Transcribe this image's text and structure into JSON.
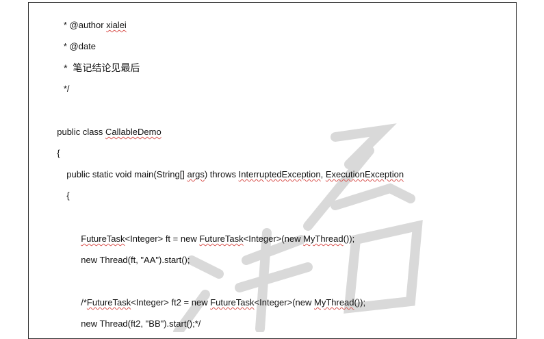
{
  "document": {
    "lines": [
      {
        "text": " * @author ",
        "word": "xialei"
      },
      {
        "text": " * @date"
      },
      {
        "text": " *  笔记结论见最后"
      },
      {
        "text": " */"
      },
      {
        "text": "public class ",
        "word": "CallableDemo"
      },
      {
        "text": "{"
      },
      {
        "pre": "public static void main(String[] ",
        "word": "args",
        "mid": ") throws ",
        "word2": "InterruptedException",
        "sep": ", ",
        "word3": "ExecutionException"
      },
      {
        "text": "{"
      },
      {
        "word": "FutureTask",
        "mid": "<Integer> ft = new ",
        "word2": "FutureTask",
        "mid2": "<Integer>(new ",
        "word3": "MyThread",
        "post": "());"
      },
      {
        "text": "new Thread(ft, \"AA\").start();"
      },
      {
        "pre": "/*",
        "word": "FutureTask",
        "mid": "<Integer> ft2 = new ",
        "word2": "FutureTask",
        "mid2": "<Integer>(new ",
        "word3": "MyThread",
        "post": "());"
      },
      {
        "text": "new Thread(ft2, \"BB\").start();*/"
      }
    ]
  },
  "watermark": {
    "text": "链石"
  }
}
